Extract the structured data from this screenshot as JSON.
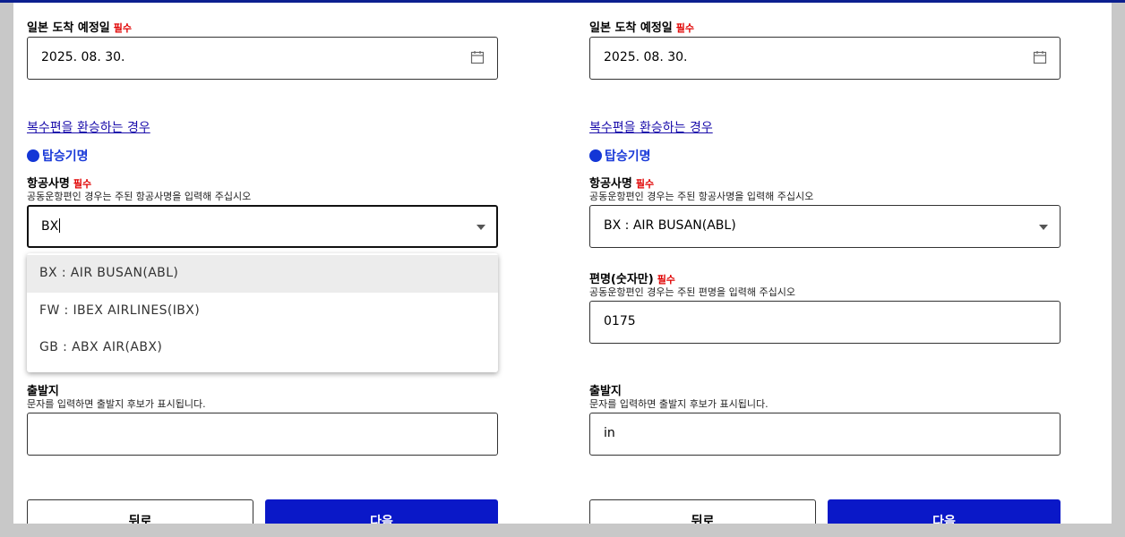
{
  "left": {
    "arrival_label": "일본 도착 예정일",
    "required": "필수",
    "arrival_date": "2025. 08. 30.",
    "transfer_link": "복수편을 환승하는 경우",
    "section_title": "탑승기명",
    "airline_label": "항공사명",
    "airline_hint": "공동운항편인 경우는 주된 항공사명을 입력해 주십시오",
    "airline_value": "BX",
    "dropdown_options": [
      "BX : AIR BUSAN(ABL)",
      "FW : IBEX AIRLINES(IBX)",
      "GB : ABX AIR(ABX)"
    ],
    "departure_label": "출발지",
    "departure_hint": "문자를 입력하면 출발지 후보가 표시됩니다.",
    "departure_value": "",
    "back_button": "뒤로",
    "next_button": "다음"
  },
  "right": {
    "arrival_label": "일본 도착 예정일",
    "required": "필수",
    "arrival_date": "2025. 08. 30.",
    "transfer_link": "복수편을 환승하는 경우",
    "section_title": "탑승기명",
    "airline_label": "항공사명",
    "airline_hint": "공동운항편인 경우는 주된 항공사명을 입력해 주십시오",
    "airline_value": "BX : AIR BUSAN(ABL)",
    "flight_label": "편명(숫자만)",
    "flight_hint": "공동운항편인 경우는 주된 편명을 입력해 주십시오",
    "flight_value": "0175",
    "departure_label": "출발지",
    "departure_hint": "문자를 입력하면 출발지 후보가 표시됩니다.",
    "departure_value": "in",
    "back_button": "뒤로",
    "next_button": "다음"
  },
  "icons": {
    "date": "calendar-icon",
    "select": "triangle-down-icon",
    "section": "filled-circle-icon"
  },
  "colors": {
    "required": "#e00000",
    "link": "#1a0dab",
    "primary_button": "#0a18c8",
    "section_dot": "#1336d6"
  }
}
